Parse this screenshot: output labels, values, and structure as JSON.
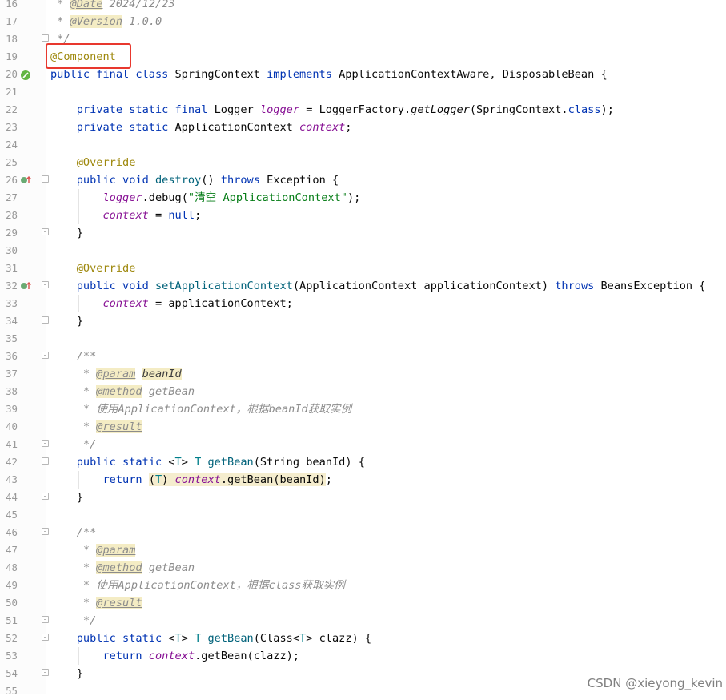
{
  "lines": [
    {
      "n": "16"
    },
    {
      "n": "17"
    },
    {
      "n": "18"
    },
    {
      "n": "19"
    },
    {
      "n": "20"
    },
    {
      "n": "21"
    },
    {
      "n": "22"
    },
    {
      "n": "23"
    },
    {
      "n": "24"
    },
    {
      "n": "25"
    },
    {
      "n": "26"
    },
    {
      "n": "27"
    },
    {
      "n": "28"
    },
    {
      "n": "29"
    },
    {
      "n": "30"
    },
    {
      "n": "31"
    },
    {
      "n": "32"
    },
    {
      "n": "33"
    },
    {
      "n": "34"
    },
    {
      "n": "35"
    },
    {
      "n": "36"
    },
    {
      "n": "37"
    },
    {
      "n": "38"
    },
    {
      "n": "39"
    },
    {
      "n": "40"
    },
    {
      "n": "41"
    },
    {
      "n": "42"
    },
    {
      "n": "43"
    },
    {
      "n": "44"
    },
    {
      "n": "45"
    },
    {
      "n": "46"
    },
    {
      "n": "47"
    },
    {
      "n": "48"
    },
    {
      "n": "49"
    },
    {
      "n": "50"
    },
    {
      "n": "51"
    },
    {
      "n": "52"
    },
    {
      "n": "53"
    },
    {
      "n": "54"
    },
    {
      "n": "55"
    }
  ],
  "code": {
    "l16": {
      "star": " * ",
      "tag": "@Date",
      "val": " 2024/12/23"
    },
    "l17": {
      "star": " * ",
      "tag": "@Version",
      "val": " 1.0.0"
    },
    "l18": {
      "end": " */"
    },
    "l19": {
      "ann": "@Component"
    },
    "l20": {
      "kw1": "public final class ",
      "name": "SpringContext ",
      "kw2": "implements ",
      "rest": "ApplicationContextAware, DisposableBean {"
    },
    "l22": {
      "kw": "    private static final ",
      "t": "Logger ",
      "f": "logger",
      "eq": " = LoggerFactory.",
      "m": "getLogger",
      "a": "(SpringContext.",
      "k": "class",
      "e": ");"
    },
    "l23": {
      "kw": "    private static ",
      "t": "ApplicationContext ",
      "f": "context",
      "e": ";"
    },
    "l25": {
      "ann": "    @Override"
    },
    "l26": {
      "kw": "    public void ",
      "m": "destroy",
      "a": "() ",
      "k": "throws ",
      "e": "Exception {"
    },
    "l27": {
      "ind": "        ",
      "f": "logger",
      "a": ".debug(",
      "s": "\"清空 ApplicationContext\"",
      "e": ");"
    },
    "l28": {
      "ind": "        ",
      "f": "context",
      "a": " = ",
      "k": "null",
      "e": ";"
    },
    "l29": {
      "e": "    }"
    },
    "l31": {
      "ann": "    @Override"
    },
    "l32": {
      "kw": "    public void ",
      "m": "setApplicationContext",
      "a": "(ApplicationContext applicationContext) ",
      "k": "throws ",
      "e": "BeansException {"
    },
    "l33": {
      "ind": "        ",
      "f": "context",
      "e": " = applicationContext;"
    },
    "l34": {
      "e": "    }"
    },
    "l36": {
      "c": "    /**"
    },
    "l37": {
      "star": "     * ",
      "tag": "@param",
      "sp": " ",
      "val": "beanId"
    },
    "l38": {
      "star": "     * ",
      "tag": "@method",
      "val": " getBean"
    },
    "l39": {
      "c": "     * 使用ApplicationContext，根据beanId获取实例"
    },
    "l40": {
      "star": "     * ",
      "tag": "@result"
    },
    "l41": {
      "c": "     */"
    },
    "l42": {
      "kw": "    public static ",
      "lt": "<",
      "t": "T",
      "gt": "> ",
      "t2": "T ",
      "m": "getBean",
      "e": "(String beanId) {"
    },
    "l43": {
      "ind": "        ",
      "k": "return ",
      "h1": "(",
      "tp": "T",
      "h2": ") ",
      "f": "context",
      "h3": ".getBean(beanId)",
      "e": ";"
    },
    "l44": {
      "e": "    }"
    },
    "l46": {
      "c": "    /**"
    },
    "l47": {
      "star": "     * ",
      "tag": "@param"
    },
    "l48": {
      "star": "     * ",
      "tag": "@method",
      "val": " getBean"
    },
    "l49": {
      "c": "     * 使用ApplicationContext，根据class获取实例"
    },
    "l50": {
      "star": "     * ",
      "tag": "@result"
    },
    "l51": {
      "c": "     */"
    },
    "l52": {
      "kw": "    public static ",
      "lt": "<",
      "t": "T",
      "gt": "> ",
      "t2": "T ",
      "m": "getBean",
      "a": "(Class<",
      "t3": "T",
      "e": "> clazz) {"
    },
    "l53": {
      "ind": "        ",
      "k": "return ",
      "f": "context",
      "e": ".getBean(clazz);"
    },
    "l54": {
      "e": "    }"
    }
  },
  "watermark": "CSDN @xieyong_kevin",
  "colors": {
    "keyword": "#0033b3",
    "annotation": "#9e880d",
    "string": "#067d17",
    "field": "#871094",
    "highlight_box": "#e8382e"
  },
  "gutter_icons": [
    "bean-icon",
    "override-icon",
    "override-icon"
  ]
}
